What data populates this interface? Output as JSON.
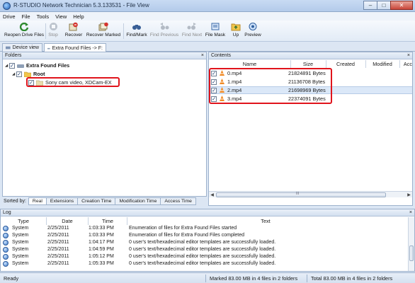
{
  "window": {
    "title": "R-STUDIO Network Technician 5.3.133531 - File View",
    "buttons": {
      "minimize": "–",
      "maximize": "□",
      "close": "✕"
    }
  },
  "menu": [
    "Drive",
    "File",
    "Tools",
    "View",
    "Help"
  ],
  "toolbar": {
    "reopen": "Reopen Drive Files",
    "stop": "Stop",
    "recover": "Recover",
    "recover_marked": "Recover Marked",
    "find_mark": "Find/Mark",
    "find_previous": "Find Previous",
    "find_next": "Find Next",
    "file_mask": "File Mask",
    "up": "Up",
    "preview": "Preview"
  },
  "tabs": {
    "device_view": "Device view",
    "extra_found": "Extra Found Files -> F:"
  },
  "folders": {
    "title": "Folders",
    "close": "×",
    "tree": {
      "extra": "Extra Found Files",
      "root": "Root",
      "sony": "Sony cam video, XDCam-EX"
    }
  },
  "sort": {
    "label": "Sorted by:",
    "tabs": [
      "Real",
      "Extensions",
      "Creation Time",
      "Modification Time",
      "Access Time"
    ]
  },
  "contents": {
    "title": "Contents",
    "close": "×",
    "columns": [
      "Name",
      "Size",
      "Created",
      "Modified",
      "Acc"
    ],
    "files": [
      {
        "name": "0.mp4",
        "size": "21824891 Bytes"
      },
      {
        "name": "1.mp4",
        "size": "21136708 Bytes"
      },
      {
        "name": "2.mp4",
        "size": "21698969 Bytes"
      },
      {
        "name": "3.mp4",
        "size": "22374091 Bytes"
      }
    ],
    "scroll_mark": "III"
  },
  "log": {
    "title": "Log",
    "close": "×",
    "columns": [
      "Type",
      "Date",
      "Time",
      "Text"
    ],
    "rows": [
      {
        "type": "System",
        "date": "2/25/2011",
        "time": "1:03:33 PM",
        "text": "Enumeration of files for Extra Found Files started"
      },
      {
        "type": "System",
        "date": "2/25/2011",
        "time": "1:03:33 PM",
        "text": "Enumeration of files for Extra Found Files completed"
      },
      {
        "type": "System",
        "date": "2/25/2011",
        "time": "1:04:17 PM",
        "text": "0 user's text/hexadecimal editor templates are successfully loaded."
      },
      {
        "type": "System",
        "date": "2/25/2011",
        "time": "1:04:59 PM",
        "text": "0 user's text/hexadecimal editor templates are successfully loaded."
      },
      {
        "type": "System",
        "date": "2/25/2011",
        "time": "1:05:12 PM",
        "text": "0 user's text/hexadecimal editor templates are successfully loaded."
      },
      {
        "type": "System",
        "date": "2/25/2011",
        "time": "1:05:33 PM",
        "text": "0 user's text/hexadecimal editor templates are successfully loaded."
      }
    ]
  },
  "status": {
    "ready": "Ready",
    "marked": "Marked 83.00 MB in 4 files in 2 folders",
    "total": "Total 83.00 MB in 4 files in 2 folders"
  },
  "colors": {
    "highlight_box": "#e0141c",
    "selected_row": "#dbe8f8",
    "chrome": "#dbe6f4"
  }
}
